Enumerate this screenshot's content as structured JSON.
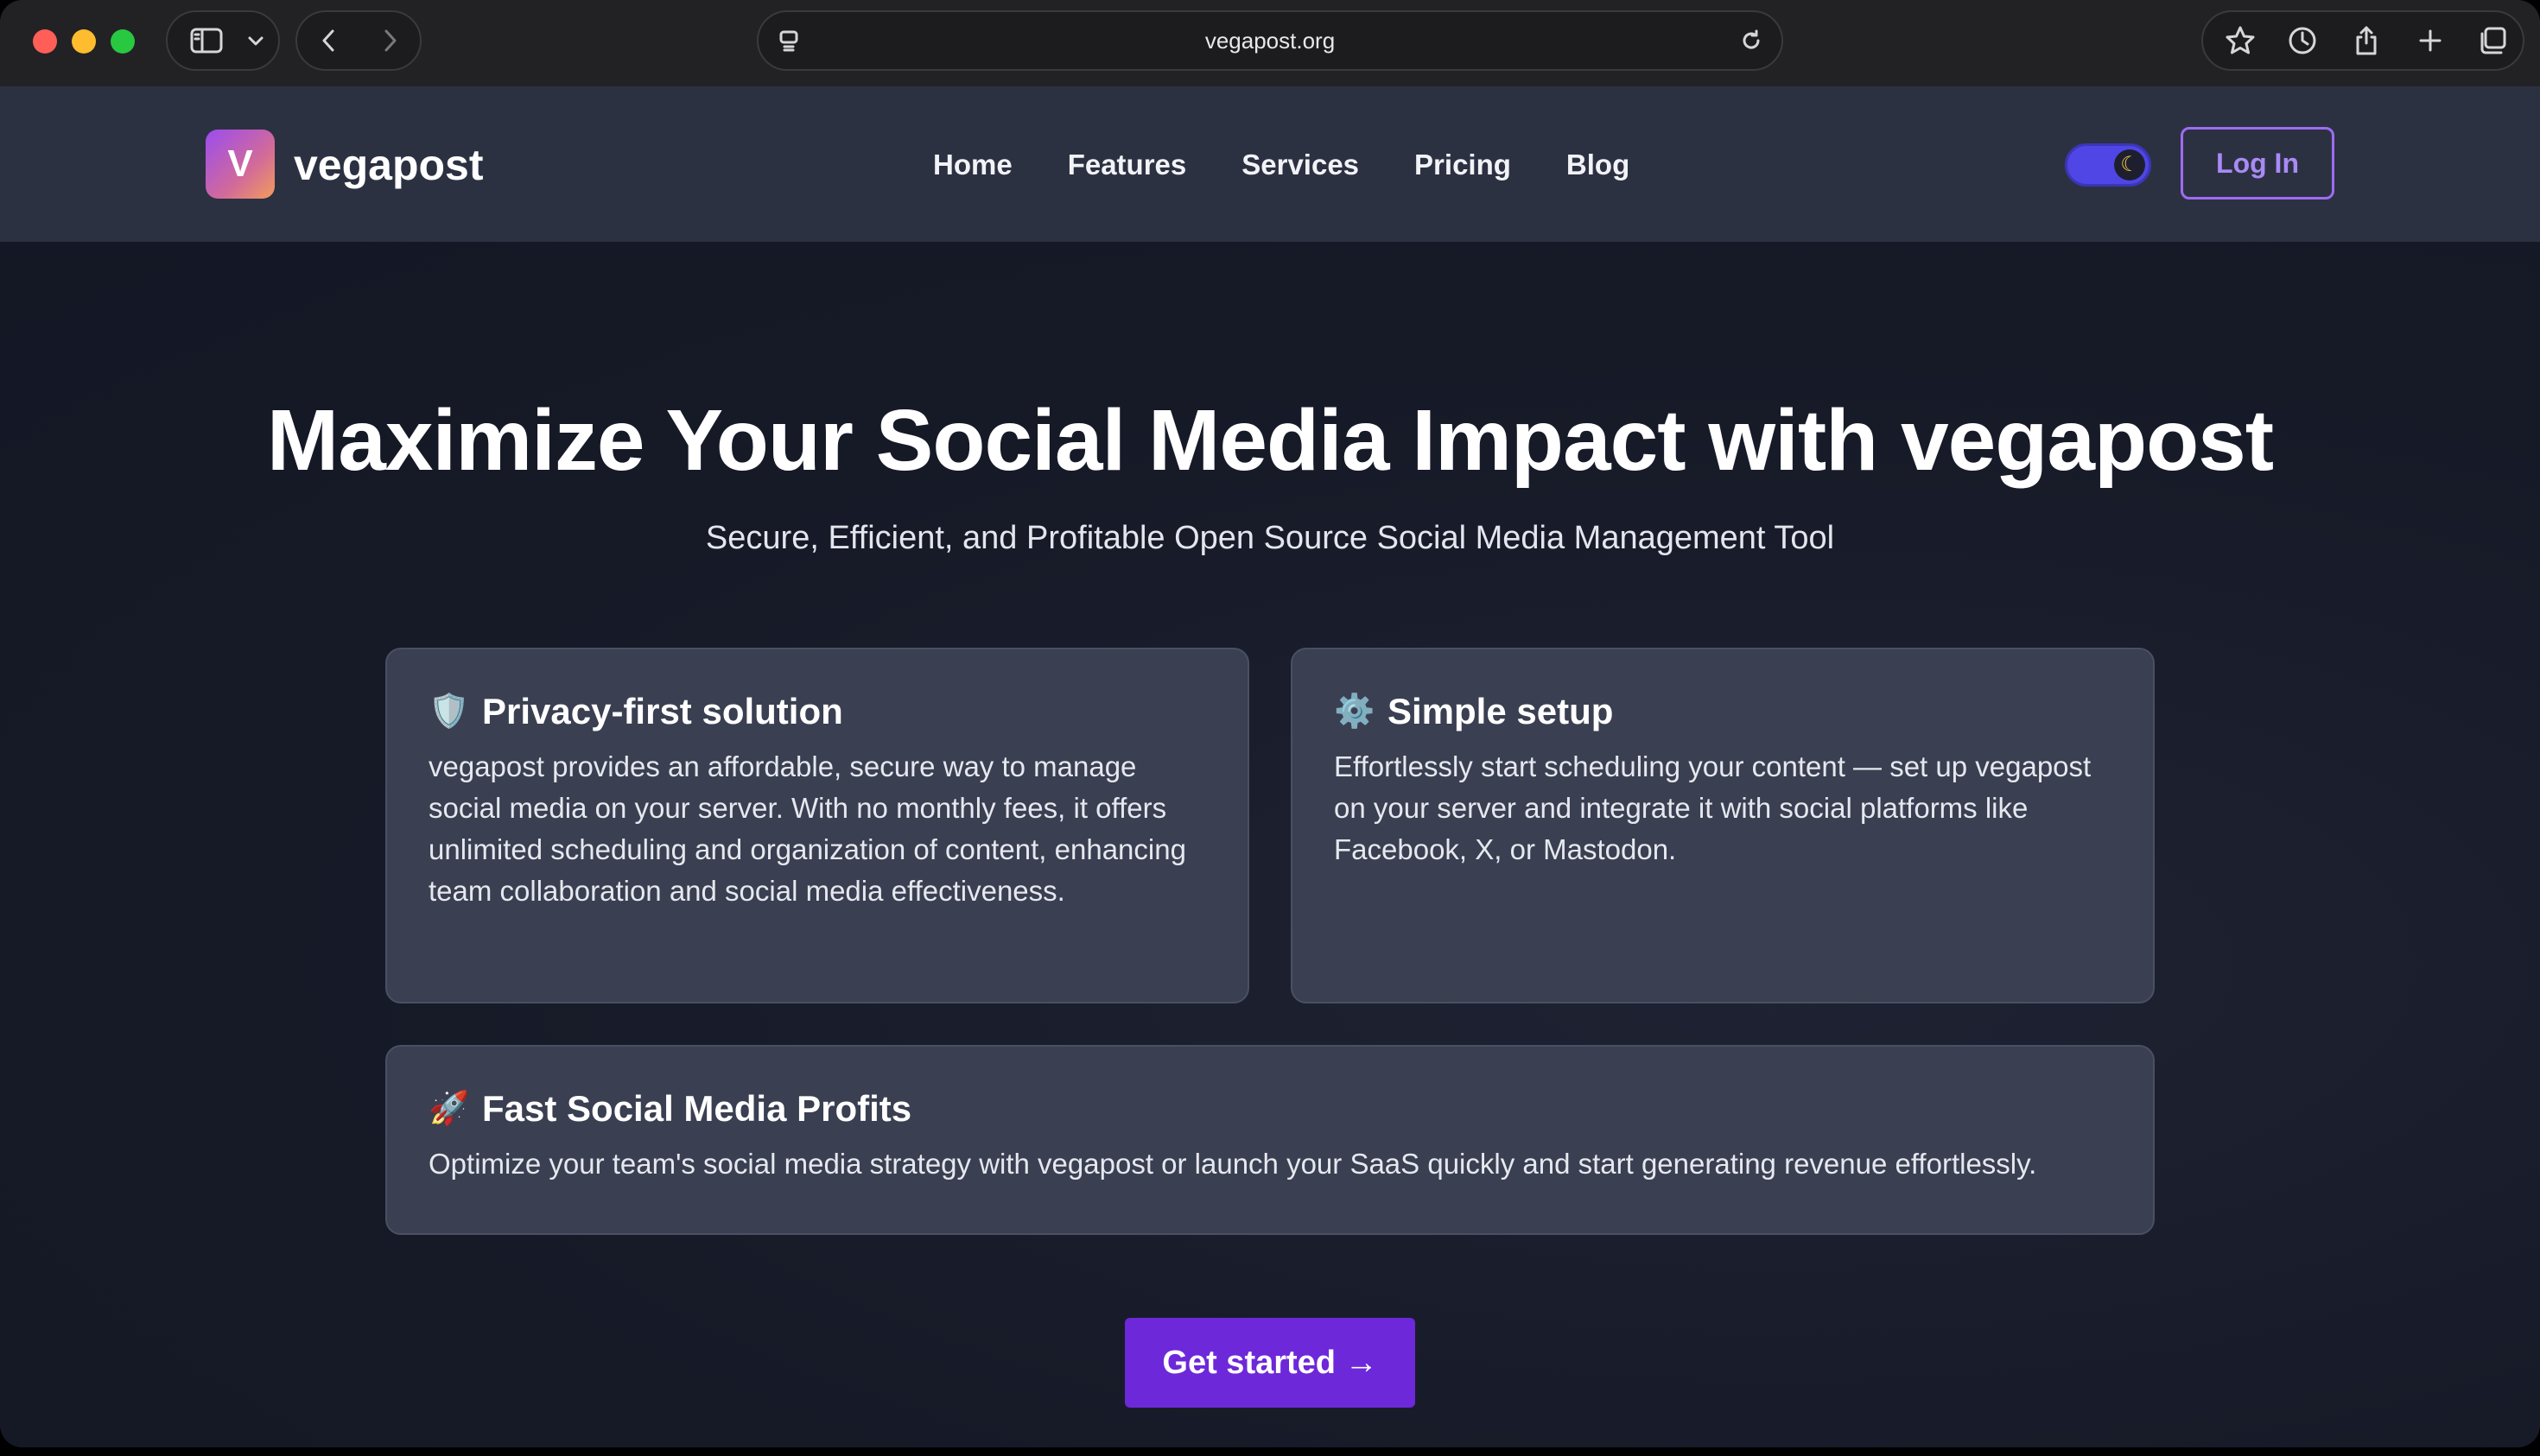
{
  "browser": {
    "url": "vegapost.org",
    "icons": [
      "sidebar-icon",
      "chevron-down-icon",
      "back-icon",
      "forward-icon",
      "page-icon",
      "reload-icon",
      "star-icon",
      "history-icon",
      "share-icon",
      "new-tab-icon",
      "tabs-overview-icon"
    ]
  },
  "header": {
    "logo_letter": "V",
    "logo_text": "vegapost",
    "nav": [
      "Home",
      "Features",
      "Services",
      "Pricing",
      "Blog"
    ],
    "theme_toggle_icon": "☾",
    "login_label": "Log In"
  },
  "hero": {
    "headline": "Maximize Your Social Media Impact with vegapost",
    "subheadline": "Secure, Efficient, and Profitable Open Source Social Media Management Tool",
    "cta_label": "Get started →"
  },
  "features": [
    {
      "icon": "🛡️",
      "icon_name": "shield-icon",
      "title": "Privacy-first solution",
      "text": "vegapost provides an affordable, secure way to manage social media on your server. With no monthly fees, it offers unlimited scheduling and organization of content, enhancing team collaboration and social media effectiveness."
    },
    {
      "icon": "⚙️",
      "icon_name": "gear-icon",
      "title": "Simple setup",
      "text": "Effortlessly start scheduling your content — set up vegapost on your server and integrate it with social platforms like Facebook, X, or Mastodon."
    },
    {
      "icon": "🚀",
      "icon_name": "rocket-icon",
      "title": "Fast Social Media Profits",
      "text": "Optimize your team's social media strategy with vegapost or launch your SaaS quickly and start generating revenue effortlessly."
    }
  ],
  "colors": {
    "accent": "#6d28d9",
    "login_border": "#9d6cf2",
    "toggle": "#4f46e5",
    "card_bg": "#3a3f51",
    "header_bg": "#2c3142",
    "page_bg": "#171b29"
  }
}
